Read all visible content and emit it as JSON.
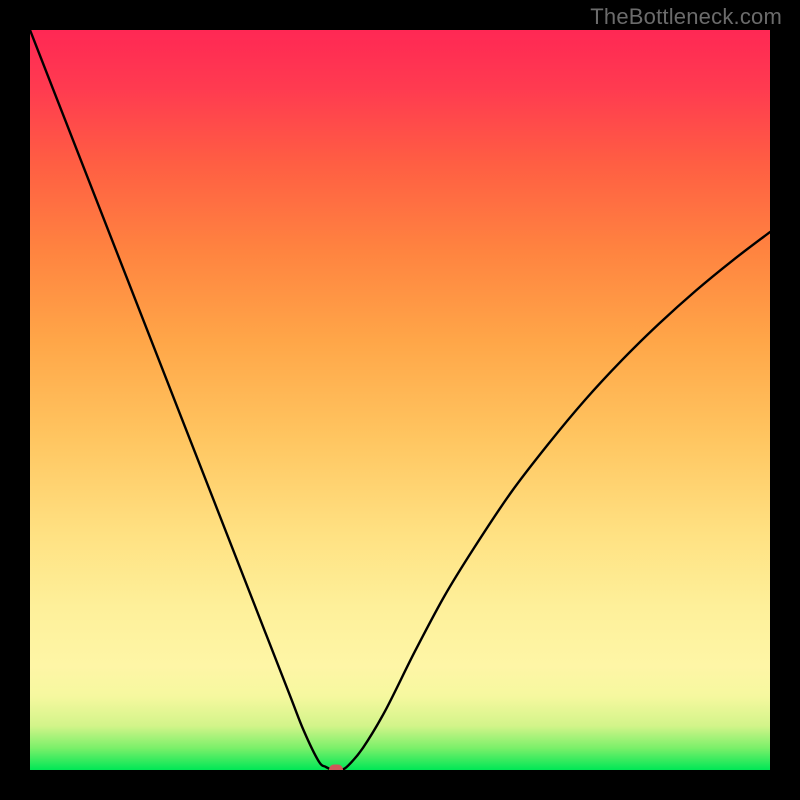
{
  "watermark": "TheBottleneck.com",
  "colors": {
    "background": "#000000",
    "curve": "#000000",
    "marker": "#d15a5a",
    "gradient_top": "#ff2854",
    "gradient_bottom": "#00e756"
  },
  "chart_data": {
    "type": "line",
    "title": "",
    "xlabel": "",
    "ylabel": "",
    "xlim": [
      0,
      100
    ],
    "ylim": [
      0,
      100
    ],
    "series": [
      {
        "name": "bottleneck-curve",
        "x": [
          0,
          5,
          10,
          15,
          20,
          25,
          30,
          35,
          37,
          39,
          40,
          41,
          42,
          43,
          45,
          48,
          52,
          56,
          60,
          65,
          70,
          75,
          80,
          85,
          90,
          95,
          100
        ],
        "y": [
          100,
          87.2,
          74.4,
          61.6,
          48.8,
          36.0,
          23.2,
          10.4,
          5.3,
          1.2,
          0.4,
          0.0,
          0.0,
          0.6,
          3.0,
          8.0,
          16.0,
          23.5,
          30.0,
          37.5,
          44.0,
          50.0,
          55.4,
          60.3,
          64.8,
          68.9,
          72.7
        ]
      }
    ],
    "marker": {
      "x": 41.3,
      "y": 0.0
    }
  }
}
